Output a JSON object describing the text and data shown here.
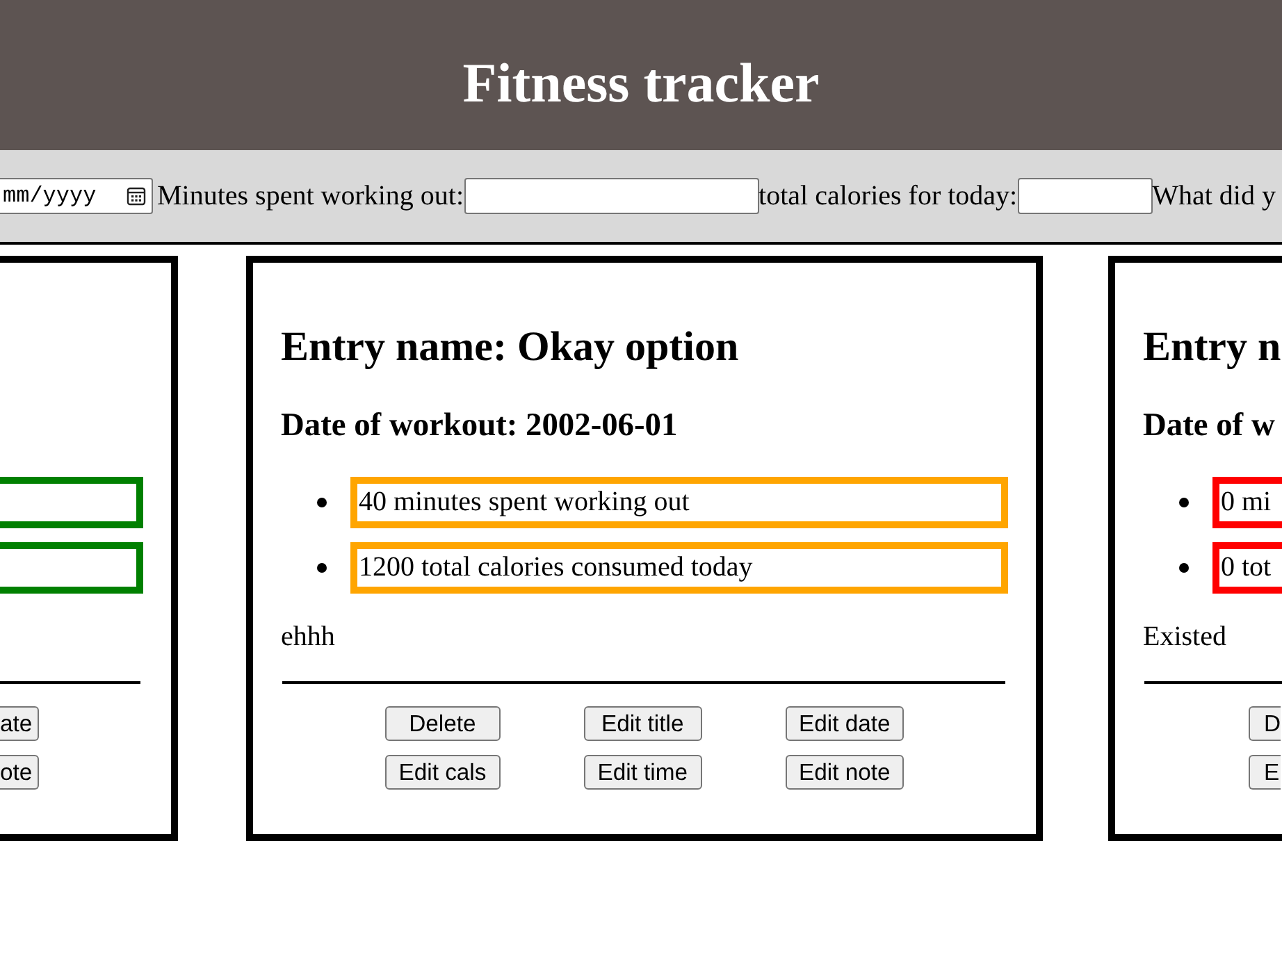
{
  "header": {
    "title": "Fitness tracker"
  },
  "form": {
    "date_field": {
      "placeholder": "mm/yyyy"
    },
    "fields": [
      {
        "label": "Minutes spent working out:",
        "kind": "text"
      },
      {
        "label": "total calories for today:",
        "kind": "number"
      },
      {
        "label": "What did y"
      }
    ]
  },
  "entries": [
    {
      "stats": [
        {
          "color": "#008000"
        },
        {
          "color": "#008000"
        }
      ],
      "buttons": [
        "ate",
        "ote"
      ]
    },
    {
      "title": "Entry name: Okay option",
      "date": "Date of workout: 2002-06-01",
      "stats": [
        {
          "text": "40 minutes spent working out",
          "color": "#ffa500"
        },
        {
          "text": "1200 total calories consumed today",
          "color": "#ffa500"
        }
      ],
      "note": "ehhh",
      "buttons": [
        "Delete",
        "Edit title",
        "Edit date",
        "Edit cals",
        "Edit time",
        "Edit note"
      ]
    },
    {
      "title": "Entry n",
      "date": "Date of w",
      "stats": [
        {
          "text": "0 mi",
          "color": "#ff0000"
        },
        {
          "text": "0 tot",
          "color": "#ff0000"
        }
      ],
      "note": "Existed",
      "buttons": [
        "D",
        "E"
      ]
    }
  ]
}
